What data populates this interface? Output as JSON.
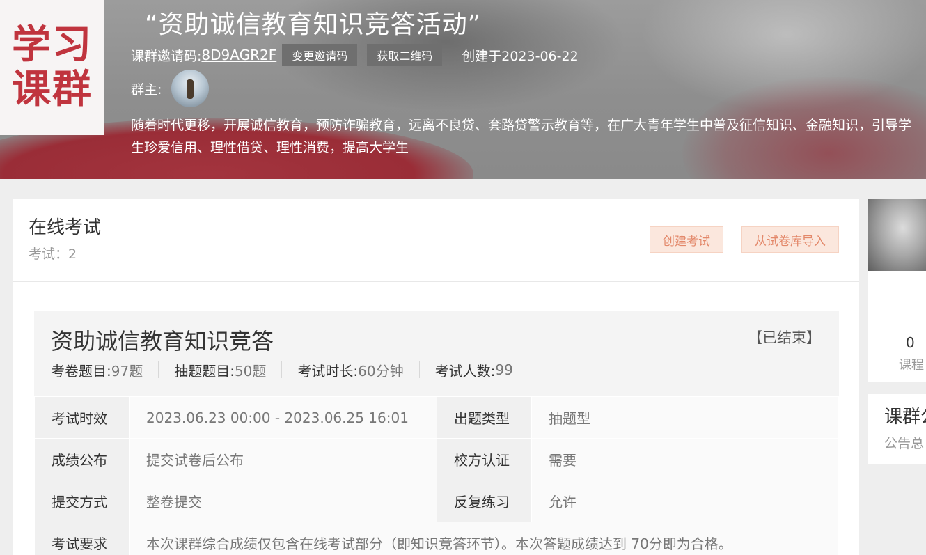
{
  "logo": {
    "line1": "学习",
    "line2": "课群"
  },
  "group": {
    "title": "“资助诚信教育知识竞答活动”",
    "invite_label": "课群邀请码:",
    "invite_code": "8D9AGR2F",
    "change_invite_button": "变更邀请码",
    "qrcode_button": "获取二维码",
    "created": "创建于2023-06-22",
    "owner_label": "群主:",
    "description": "随着时代更移，开展诚信教育，预防诈骗教育，远离不良贷、套路贷警示教育等，在广大青年学生中普及征信知识、金融知识，引导学生珍爱信用、理性借贷、理性消费，提高大学生"
  },
  "exam_section": {
    "title": "在线考试",
    "count": "考试：2",
    "create_button": "创建考试",
    "import_button": "从试卷库导入"
  },
  "exam": {
    "name": "资助诚信教育知识竞答",
    "status": "【已结束】",
    "stats": [
      {
        "key": "考卷题目:",
        "value": "97题"
      },
      {
        "key": "抽题题目:",
        "value": "50题"
      },
      {
        "key": "考试时长:",
        "value": "60分钟"
      },
      {
        "key": "考试人数:",
        "value": "99"
      }
    ],
    "rows": [
      {
        "label1": "考试时效",
        "value1": "2023.06.23 00:00 - 2023.06.25 16:01",
        "label2": "出题类型",
        "value2": "抽题型"
      },
      {
        "label1": "成绩公布",
        "value1": "提交试卷后公布",
        "label2": "校方认证",
        "value2": "需要"
      },
      {
        "label1": "提交方式",
        "value1": "整卷提交",
        "label2": "反复练习",
        "value2": "允许"
      }
    ],
    "requirement_label": "考试要求",
    "requirement": "本次课群综合成绩仅包含在线考试部分（即知识竞答环节）。本次答题成绩达到 70分即为合格。"
  },
  "sidebar": {
    "course_count": "0",
    "course_label": "课程",
    "notice_title": "课群公",
    "notice_sub": "公告总"
  }
}
